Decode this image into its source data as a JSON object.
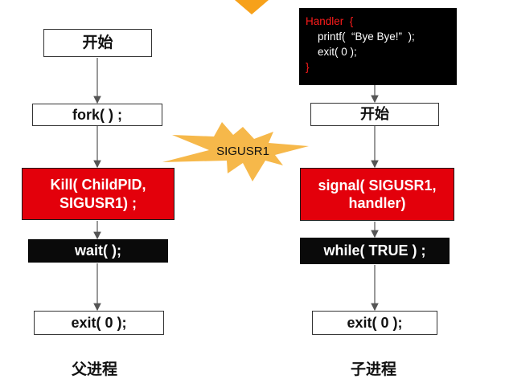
{
  "parent": {
    "start": "开始",
    "fork": "fork(  ) ;",
    "kill": "Kill( ChildPID,\nSIGUSR1) ;",
    "wait": "wait(   );",
    "exit": "exit( 0 );",
    "caption": "父进程"
  },
  "child": {
    "handler_code": {
      "line1": "Handler  {",
      "line2": "    printf(  “Bye Bye!”  );",
      "line3": "    exit( 0 );",
      "line4": "}"
    },
    "start": "开始",
    "signal": "signal( SIGUSR1,\nhandler)",
    "while": "while(  TRUE ) ;",
    "exit": "exit( 0 );",
    "caption": "子进程"
  },
  "signal_burst": {
    "label": "SIGUSR1"
  },
  "colors": {
    "red": "#e3000b",
    "black": "#0a0a0a",
    "burst": "#f6b84a",
    "triangle": "#f7a11a"
  }
}
